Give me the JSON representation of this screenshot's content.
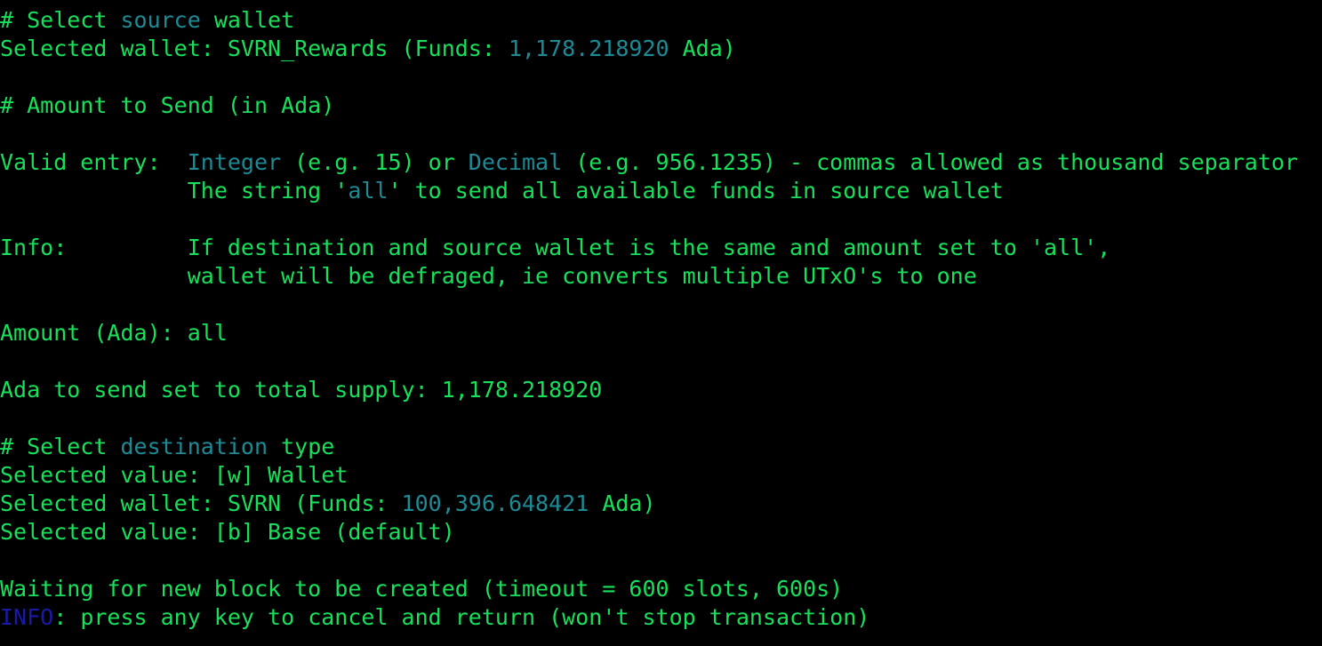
{
  "colors": {
    "background": "#000000",
    "text_green": "#18e05a",
    "highlight_teal": "#1e8a96",
    "info_blue": "#1a1aa8"
  },
  "lines": [
    {
      "id": "select-source-heading",
      "segments": [
        {
          "text": "# Select ",
          "style": "normal"
        },
        {
          "text": "source",
          "style": "hl"
        },
        {
          "text": " wallet",
          "style": "normal"
        }
      ]
    },
    {
      "id": "selected-source-wallet",
      "segments": [
        {
          "text": "Selected wallet: SVRN_Rewards (Funds: ",
          "style": "normal"
        },
        {
          "text": "1,178.218920",
          "style": "hl"
        },
        {
          "text": " Ada)",
          "style": "normal"
        }
      ]
    },
    {
      "id": "blank",
      "segments": []
    },
    {
      "id": "amount-heading",
      "segments": [
        {
          "text": "# Amount to Send (in Ada)",
          "style": "normal"
        }
      ]
    },
    {
      "id": "blank",
      "segments": []
    },
    {
      "id": "valid-entry-line-1",
      "segments": [
        {
          "text": "Valid entry:  ",
          "style": "normal"
        },
        {
          "text": "Integer",
          "style": "hl"
        },
        {
          "text": " (e.g. 15) or ",
          "style": "normal"
        },
        {
          "text": "Decimal",
          "style": "hl"
        },
        {
          "text": " (e.g. 956.1235) - commas allowed as thousand separator",
          "style": "normal"
        }
      ]
    },
    {
      "id": "valid-entry-line-2",
      "segments": [
        {
          "text": "              The string '",
          "style": "normal"
        },
        {
          "text": "all",
          "style": "hl"
        },
        {
          "text": "' to send all available funds in source wallet",
          "style": "normal"
        }
      ]
    },
    {
      "id": "blank",
      "segments": []
    },
    {
      "id": "info-line-1",
      "segments": [
        {
          "text": "Info:         If destination and source wallet is the same and amount set to 'all',",
          "style": "normal"
        }
      ]
    },
    {
      "id": "info-line-2",
      "segments": [
        {
          "text": "              wallet will be defraged, ie converts multiple UTxO's to one",
          "style": "normal"
        }
      ]
    },
    {
      "id": "blank",
      "segments": []
    },
    {
      "id": "amount-input",
      "segments": [
        {
          "text": "Amount (Ada): all",
          "style": "normal"
        }
      ]
    },
    {
      "id": "blank",
      "segments": []
    },
    {
      "id": "ada-total-supply",
      "segments": [
        {
          "text": "Ada to send set to total supply: 1,178.218920",
          "style": "normal"
        }
      ]
    },
    {
      "id": "blank",
      "segments": []
    },
    {
      "id": "select-destination-heading",
      "segments": [
        {
          "text": "# Select ",
          "style": "normal"
        },
        {
          "text": "destination",
          "style": "hl"
        },
        {
          "text": " type",
          "style": "normal"
        }
      ]
    },
    {
      "id": "selected-value-wallet",
      "segments": [
        {
          "text": "Selected value: [w] Wallet",
          "style": "normal"
        }
      ]
    },
    {
      "id": "selected-destination-wallet",
      "segments": [
        {
          "text": "Selected wallet: SVRN (Funds: ",
          "style": "normal"
        },
        {
          "text": "100,396.648421",
          "style": "hl"
        },
        {
          "text": " Ada)",
          "style": "normal"
        }
      ]
    },
    {
      "id": "selected-value-base",
      "segments": [
        {
          "text": "Selected value: [b] Base (default)",
          "style": "normal"
        }
      ]
    },
    {
      "id": "blank",
      "segments": []
    },
    {
      "id": "waiting-block",
      "segments": [
        {
          "text": "Waiting for new block to be created (timeout = 600 slots, 600s)",
          "style": "normal"
        }
      ]
    },
    {
      "id": "info-cancel",
      "segments": [
        {
          "text": "INFO",
          "style": "dim"
        },
        {
          "text": ": press any key to cancel and return (won't stop transaction)",
          "style": "normal"
        }
      ]
    }
  ]
}
